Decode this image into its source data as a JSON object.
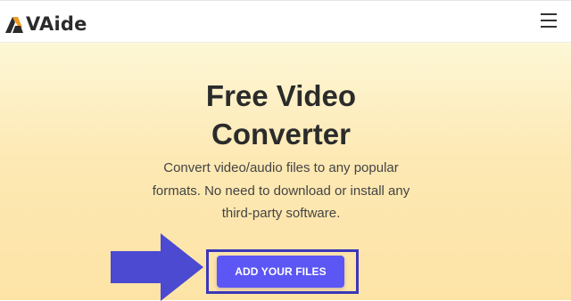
{
  "header": {
    "logo_text": "VAide",
    "logo_icon": "aiseesoft-vaide-logo-icon",
    "menu_icon": "hamburger-menu-icon"
  },
  "hero": {
    "title_line1": "Free Video",
    "title_line2": "Converter",
    "description_line1": "Convert video/audio files to any popular",
    "description_line2": "formats. No need to download or install any",
    "description_line3": "third-party software.",
    "add_button_label": "ADD YOUR FILES",
    "arrow_icon": "right-arrow-icon"
  },
  "colors": {
    "accent_button": "#5b56f4",
    "highlight_frame": "#3b37b8",
    "arrow": "#4b4ad0",
    "logo_orange": "#f39a1e",
    "hero_gradient_top": "#fdf7d6",
    "hero_gradient_bottom": "#fde3a6"
  }
}
